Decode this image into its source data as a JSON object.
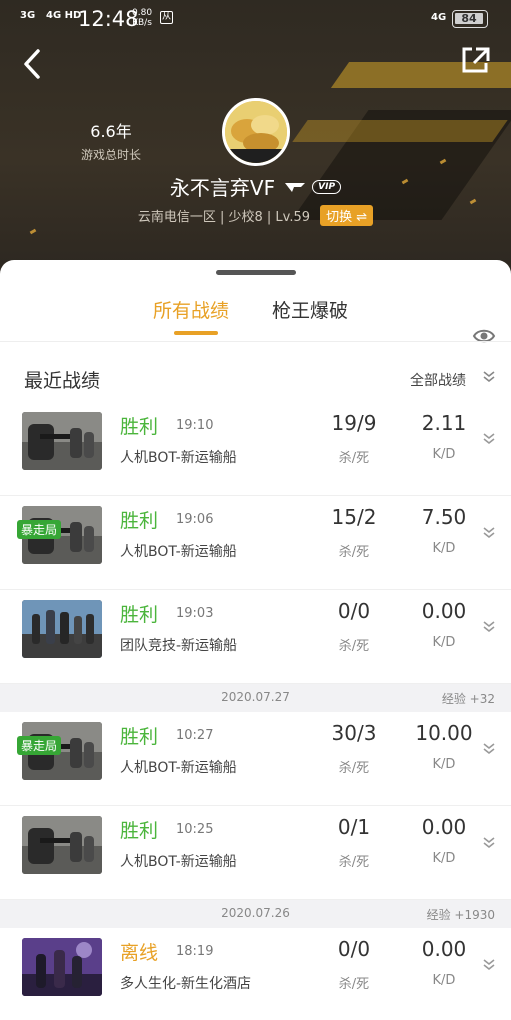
{
  "status_bar": {
    "signal_a": "3G",
    "signal_b": "4G HD",
    "time": "12:48",
    "speed_value": "0.80",
    "speed_unit": "KB/s",
    "hd_badge": "从",
    "network": "4G",
    "battery": "84"
  },
  "profile": {
    "playtime_value": "6.6年",
    "playtime_label": "游戏总时长",
    "username": "永不言弃VF",
    "vip_badge": "VIP",
    "server_info": "云南电信一区 | 少校8 | Lv.59",
    "switch_label": "切换 ⇌"
  },
  "tabs": [
    {
      "label": "所有战绩",
      "active": true
    },
    {
      "label": "枪王爆破",
      "active": false
    }
  ],
  "section": {
    "title": "最近战绩",
    "all_records_label": "全部战绩"
  },
  "labels": {
    "kills_deaths": "杀/死",
    "kd": "K/D"
  },
  "matches_group1": [
    {
      "result": "胜利",
      "time": "19:10",
      "mode": "人机BOT-新运输船",
      "kills_deaths": "19/9",
      "kd": "2.11",
      "tag": "",
      "thumb": "bot"
    },
    {
      "result": "胜利",
      "time": "19:06",
      "mode": "人机BOT-新运输船",
      "kills_deaths": "15/2",
      "kd": "7.50",
      "tag": "暴走局",
      "thumb": "bot"
    },
    {
      "result": "胜利",
      "time": "19:03",
      "mode": "团队竞技-新运输船",
      "kills_deaths": "0/0",
      "kd": "0.00",
      "tag": "",
      "thumb": "team"
    }
  ],
  "date_separator_1": {
    "date": "2020.07.27",
    "exp": "经验 +32"
  },
  "matches_group2": [
    {
      "result": "胜利",
      "time": "10:27",
      "mode": "人机BOT-新运输船",
      "kills_deaths": "30/3",
      "kd": "10.00",
      "tag": "暴走局",
      "thumb": "bot"
    },
    {
      "result": "胜利",
      "time": "10:25",
      "mode": "人机BOT-新运输船",
      "kills_deaths": "0/1",
      "kd": "0.00",
      "tag": "",
      "thumb": "bot"
    }
  ],
  "date_separator_2": {
    "date": "2020.07.26",
    "exp": "经验 +1930"
  },
  "matches_group3": [
    {
      "result": "离线",
      "time": "18:19",
      "mode": "多人生化-新生化酒店",
      "kills_deaths": "0/0",
      "kd": "0.00",
      "tag": "",
      "thumb": "zombie"
    }
  ],
  "colors": {
    "accent": "#e8a126",
    "win": "#4bb53c",
    "rampage_tag": "#36a635"
  }
}
